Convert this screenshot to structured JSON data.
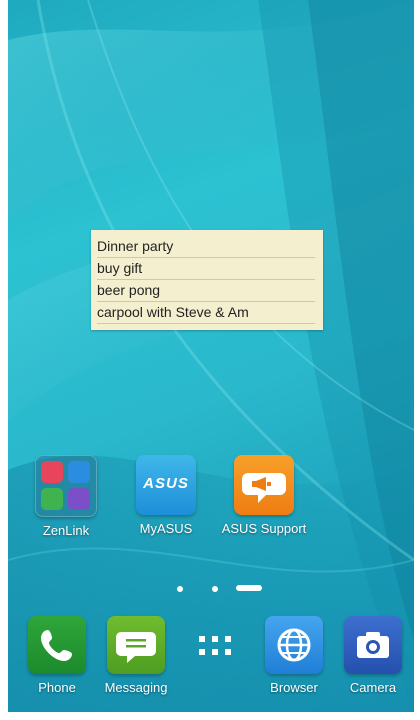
{
  "memo": {
    "lines": [
      "Dinner party",
      "buy gift",
      "beer pong",
      "carpool with Steve & Am"
    ]
  },
  "home_apps": [
    {
      "label": "ZenLink",
      "icon": "zenlink-folder-icon"
    },
    {
      "label": "MyASUS",
      "icon": "myasus-icon",
      "logo_text": "ASUS"
    },
    {
      "label": "ASUS Support",
      "icon": "asus-support-icon"
    }
  ],
  "page_indicator": {
    "pages": 3,
    "current": 3
  },
  "dock": [
    {
      "label": "Phone",
      "icon": "phone-icon"
    },
    {
      "label": "Messaging",
      "icon": "messaging-icon"
    },
    {
      "label": "",
      "icon": "all-apps-icon"
    },
    {
      "label": "Browser",
      "icon": "globe-icon"
    },
    {
      "label": "Camera",
      "icon": "camera-icon"
    }
  ],
  "colors": {
    "wallpaper": "#2cc2d2",
    "memo_bg": "#f4efcf",
    "support_orange": "#f18a1c",
    "phone_green": "#249b33"
  }
}
